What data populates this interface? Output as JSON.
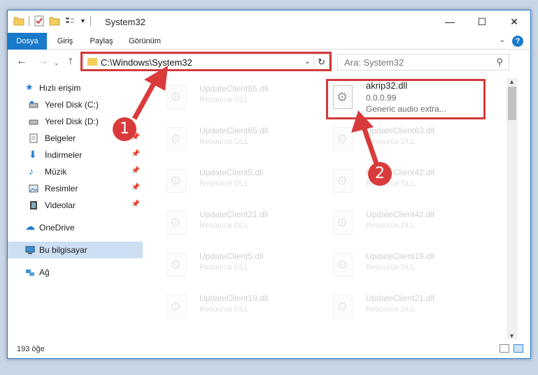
{
  "window": {
    "title": "System32"
  },
  "ribbon": {
    "tabs": [
      "Dosya",
      "Giriş",
      "Paylaş",
      "Görünüm"
    ],
    "help": "?"
  },
  "address": {
    "path": "C:\\Windows\\System32"
  },
  "search": {
    "placeholder": "Ara: System32"
  },
  "sidebar": {
    "quick_access": "Hızlı erişim",
    "items": [
      {
        "label": "Yerel Disk (C:)"
      },
      {
        "label": "Yerel Disk (D:)"
      },
      {
        "label": "Belgeler"
      },
      {
        "label": "İndirmeler"
      },
      {
        "label": "Müzik"
      },
      {
        "label": "Resimler"
      },
      {
        "label": "Videolar"
      }
    ],
    "onedrive": "OneDrive",
    "this_pc": "Bu bilgisayar",
    "network": "Ağ"
  },
  "files": [
    {
      "name": "UpdateClient65.dll",
      "desc": "Resource DLL"
    },
    {
      "name": "akrip32.dll",
      "version": "0.0.0.99",
      "desc": "Generic audio extra..."
    },
    {
      "name": "UpdateClient65.dll",
      "desc": "Resource DLL"
    },
    {
      "name": "UpdateClient63.dll",
      "desc": "Resource DLL"
    },
    {
      "name": "UpdateClient5.dll",
      "desc": "Resource DLL"
    },
    {
      "name": "UpdateClient42.dll",
      "desc": "Resource DLL"
    },
    {
      "name": "UpdateClient21.dll",
      "desc": "Resource DLL"
    },
    {
      "name": "UpdateClient42.dll",
      "desc": "Resource DLL"
    },
    {
      "name": "UpdateClient5.dll",
      "desc": "Resource DLL"
    },
    {
      "name": "UpdateClient19.dll",
      "desc": "Resource DLL"
    },
    {
      "name": "UpdateClient19.dll",
      "desc": "Resource DLL"
    },
    {
      "name": "UpdateClient21.dll",
      "desc": "Resource DLL"
    }
  ],
  "status": {
    "count": "193 öğe"
  },
  "annotations": {
    "step1": "1",
    "step2": "2",
    "color": "#d23a3a"
  }
}
